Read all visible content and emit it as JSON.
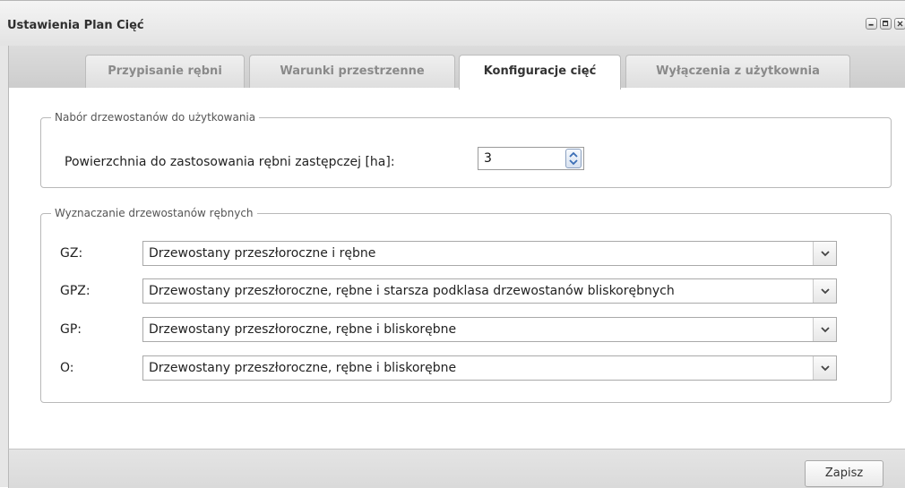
{
  "window": {
    "title": "Ustawienia Plan Cięć"
  },
  "tabs": [
    {
      "label": "Przypisanie rębni",
      "active": false
    },
    {
      "label": "Warunki przestrzenne",
      "active": false
    },
    {
      "label": "Konfiguracje cięć",
      "active": true
    },
    {
      "label": "Wyłączenia z użytkownia",
      "active": false
    }
  ],
  "group1": {
    "legend": "Nabór drzewostanów do użytkowania",
    "field_label": "Powierzchnia do zastosowania rębni zastępczej [ha]:",
    "field_value": "3"
  },
  "group2": {
    "legend": "Wyznaczanie drzewostanów rębnych",
    "rows": [
      {
        "label": "GZ:",
        "value": "Drzewostany przeszłoroczne i rębne"
      },
      {
        "label": "GPZ:",
        "value": "Drzewostany przeszłoroczne, rębne i starsza podklasa drzewostanów bliskorębnych"
      },
      {
        "label": "GP:",
        "value": "Drzewostany przeszłoroczne, rębne i bliskorębne"
      },
      {
        "label": "O:",
        "value": "Drzewostany przeszłoroczne, rębne i bliskorębne"
      }
    ]
  },
  "footer": {
    "save_label": "Zapisz"
  },
  "icons": {
    "minimize": "minimize-icon",
    "maximize": "maximize-icon",
    "close": "close-icon",
    "spinner": "spinner-up-down-icon",
    "dropdown": "chevron-down-icon"
  },
  "colors": {
    "window_bg": "#e6e6e6",
    "content_bg": "#ffffff",
    "spinner_arrow": "#3a6db5"
  }
}
